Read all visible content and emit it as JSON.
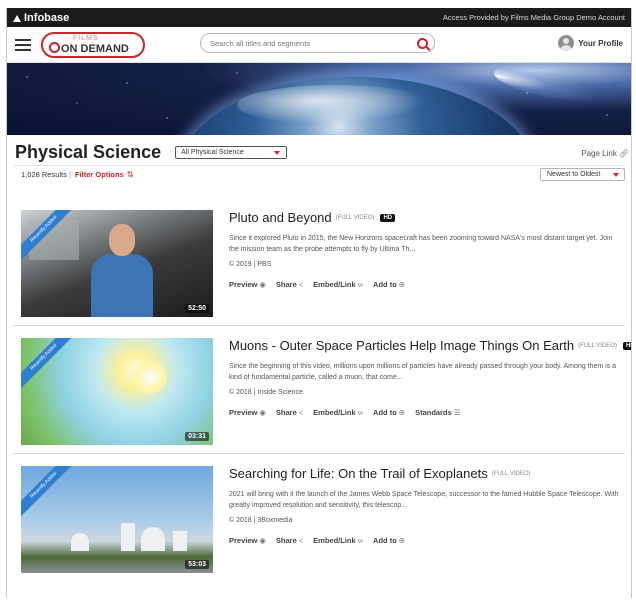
{
  "topbar": {
    "brand": "Infobase",
    "access_text": "Access Provided by Films Media Group Demo Account"
  },
  "header": {
    "logo_top": "FILMS",
    "logo_main": "ON DEMAND",
    "search_placeholder": "Search all titles and segments",
    "profile_label": "Your Profile"
  },
  "page": {
    "title": "Physical Science",
    "filter_selected": "All Physical Science",
    "page_link_label": "Page Link",
    "results_count": "1,028 Results",
    "results_sep": "|",
    "filter_options_label": "Filter Options",
    "sort_selected": "Newest to Oldest"
  },
  "items": [
    {
      "title": "Pluto and Beyond",
      "tag": "(FULL VIDEO)",
      "hd": "HD",
      "description": "Since it explored Pluto in 2015, the New Horizons spacecraft has been zooming toward NASA's most distant target yet. Join the mission team as the probe attempts to fly by Ultima Th...",
      "meta": "© 2019 | PBS",
      "duration": "52:50",
      "ribbon": "Recently Added",
      "actions": [
        "Preview",
        "Share",
        "Embed/Link",
        "Add to"
      ]
    },
    {
      "title": "Muons - Outer Space Particles Help Image Things On Earth",
      "tag": "(FULL VIDEO)",
      "hd": "HD",
      "description": "Since the beginning of this video, millions upon millions of particles have already passed through your body. Among them is a kind of fundamental particle, called a muon, that come...",
      "meta": "© 2018 | Inside Science",
      "duration": "03:31",
      "ribbon": "Recently Added",
      "actions": [
        "Preview",
        "Share",
        "Embed/Link",
        "Add to",
        "Standards"
      ]
    },
    {
      "title": "Searching for Life: On the Trail of Exoplanets",
      "tag": "(FULL VIDEO)",
      "hd": "",
      "description": "2021 will bring with it the launch of the James Webb Space Telescope, successor to the famed Hubble Space Telescope. With greatly improved resolution and sensitivity, this telescop...",
      "meta": "© 2018 | 3Boxmedia",
      "duration": "53:03",
      "ribbon": "Recently Added",
      "actions": [
        "Preview",
        "Share",
        "Embed/Link",
        "Add to"
      ]
    }
  ],
  "colors": {
    "accent": "#c8262c",
    "topbar": "#1b1b1b",
    "ribbon": "#2f7fd1"
  }
}
